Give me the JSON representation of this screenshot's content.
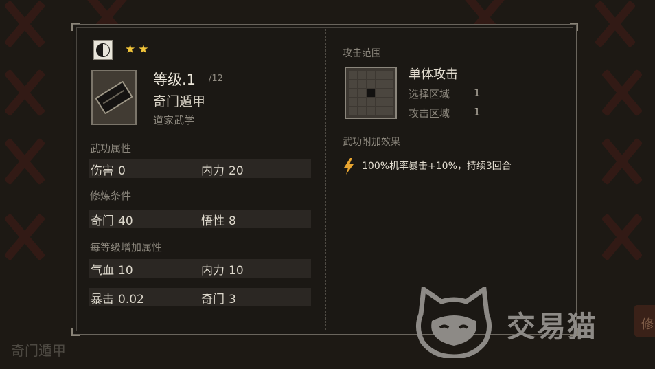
{
  "background": {
    "label": "奇门遁甲",
    "side_button_label": "修"
  },
  "skill": {
    "stars": "★★",
    "level_label": "等级.1",
    "level_max": "/12",
    "name": "奇门遁甲",
    "school": "道家武学"
  },
  "attributes": {
    "title": "武功属性",
    "items": [
      {
        "label": "伤害",
        "value": "0"
      },
      {
        "label": "内力",
        "value": "20"
      }
    ]
  },
  "requirements": {
    "title": "修炼条件",
    "items": [
      {
        "label": "奇门",
        "value": "40"
      },
      {
        "label": "悟性",
        "value": "8"
      }
    ]
  },
  "per_level": {
    "title": "每等级增加属性",
    "items": [
      {
        "label": "气血",
        "value": "10"
      },
      {
        "label": "内力",
        "value": "10"
      },
      {
        "label": "暴击",
        "value": "0.02"
      },
      {
        "label": "奇门",
        "value": "3"
      }
    ]
  },
  "attack_range": {
    "title": "攻击范围",
    "type": "单体攻击",
    "select_label": "选择区域",
    "select_value": "1",
    "attack_label": "攻击区域",
    "attack_value": "1"
  },
  "effects": {
    "title": "武功附加效果",
    "text": "100%机率暴击+10%，持续3回合"
  },
  "watermark": {
    "text": "交易猫"
  },
  "colors": {
    "star": "#f1c43a",
    "effect_icon": "#e8a530",
    "panel_border": "#6a655d"
  }
}
